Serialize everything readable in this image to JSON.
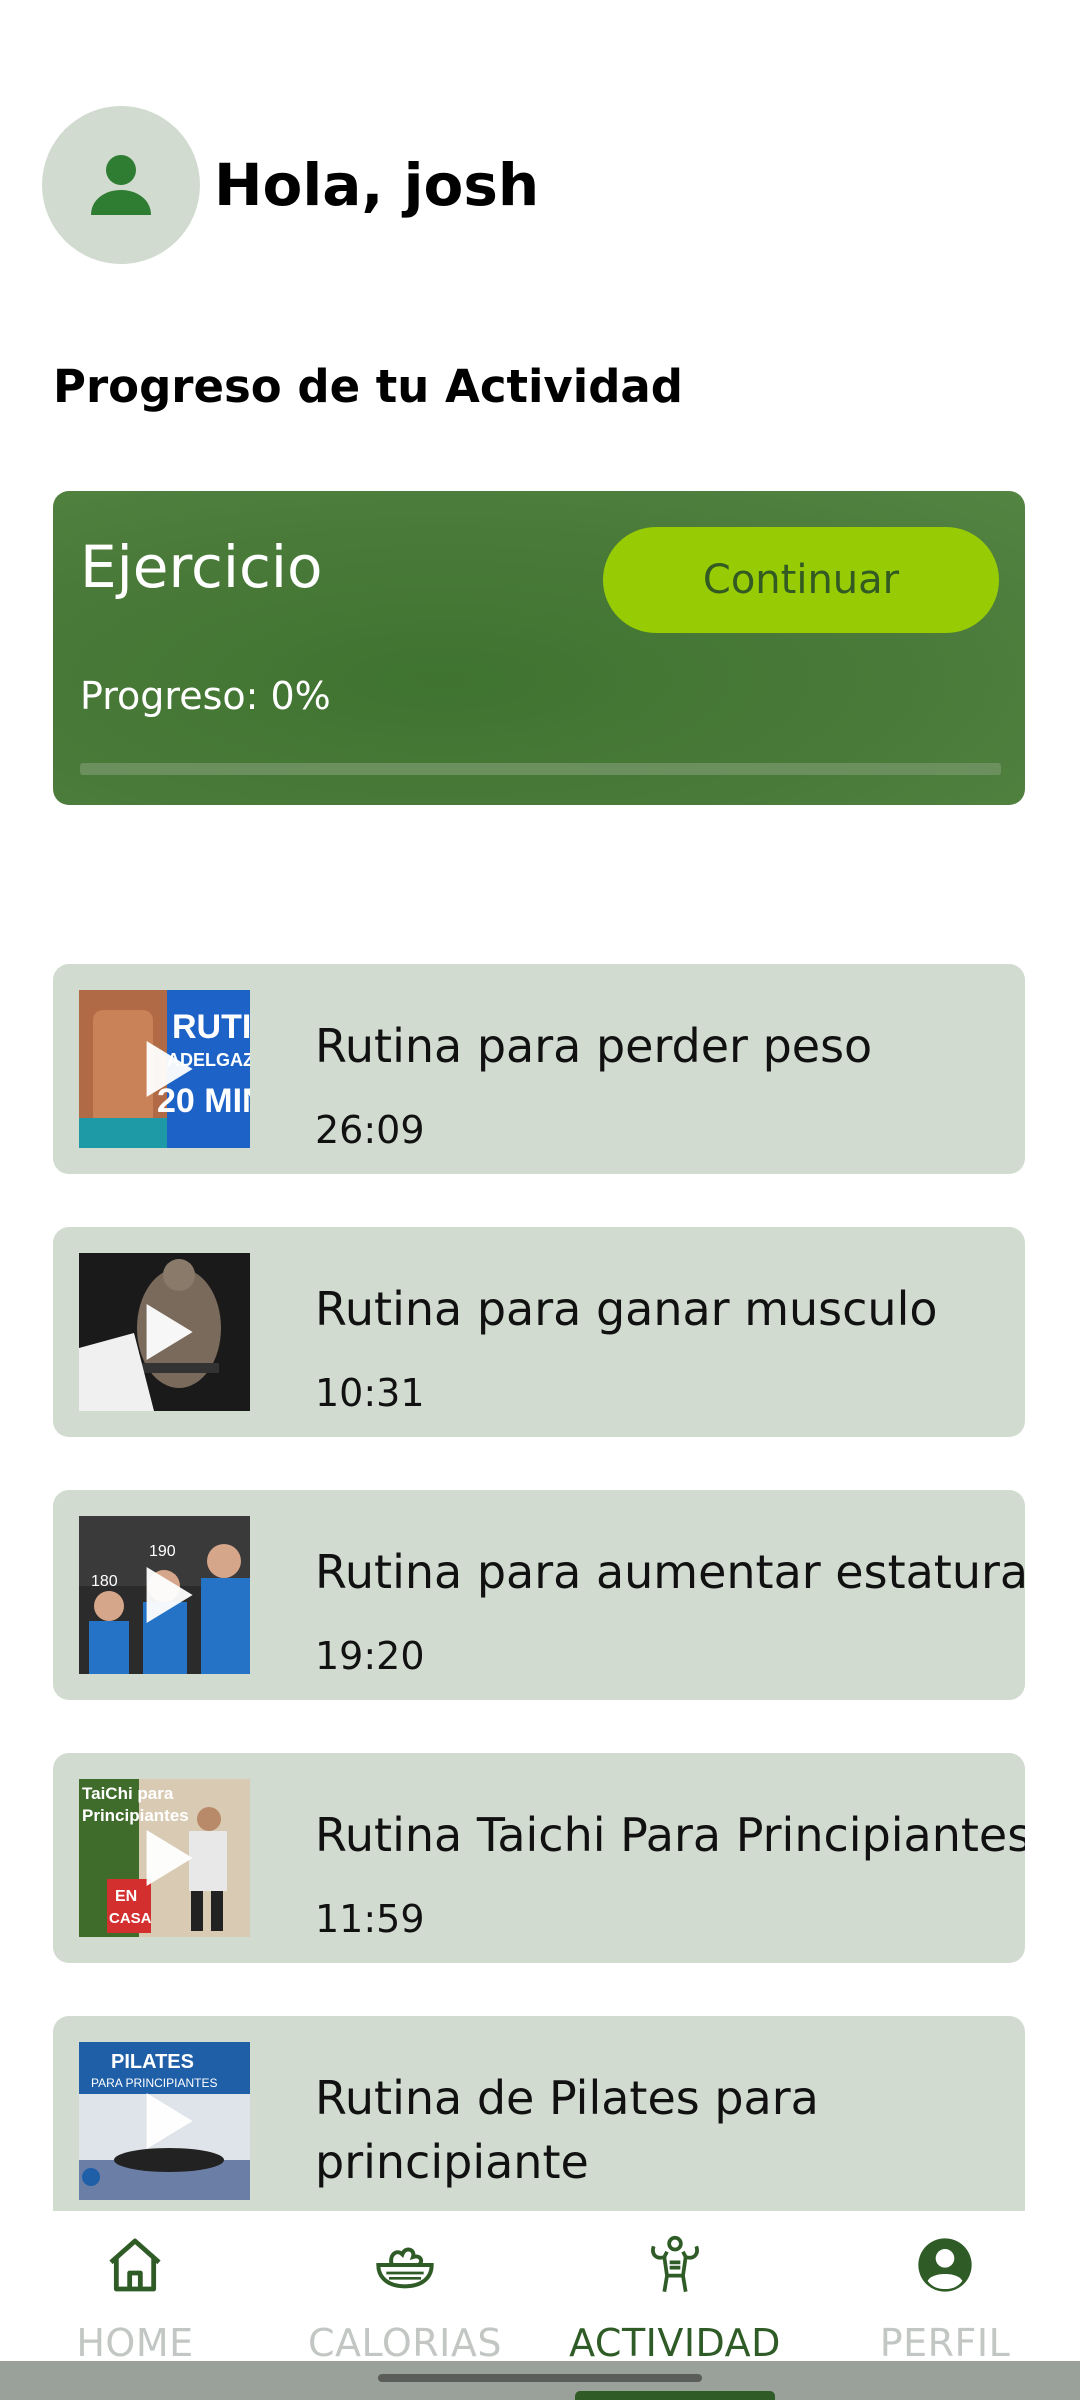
{
  "header": {
    "greeting": "Hola, josh"
  },
  "section": {
    "title": "Progreso de tu Actividad"
  },
  "progress_card": {
    "title": "Ejercicio",
    "button_label": "Continuar",
    "progress_label": "Progreso: 0%",
    "progress_fraction": 0
  },
  "videos": [
    {
      "title": "Rutina para perder peso",
      "duration": "26:09"
    },
    {
      "title": "Rutina para ganar musculo",
      "duration": "10:31"
    },
    {
      "title": "Rutina para aumentar estatura",
      "duration": "19:20"
    },
    {
      "title": "Rutina Taichi Para Principiantes",
      "duration": "11:59"
    },
    {
      "title": "Rutina de Pilates para principiante",
      "duration": ""
    }
  ],
  "thumbnail_text": {
    "t1": [
      "RUTIN",
      "ADELGAZA",
      "20 MIN"
    ],
    "t2": [
      "190",
      "180"
    ],
    "t4": [
      "TaiChi para",
      "Principiantes",
      "EN",
      "CASA"
    ],
    "t5": [
      "PILATES",
      "PARA PRINCIPIANTES"
    ]
  },
  "nav": {
    "items": [
      {
        "label": "HOME",
        "icon": "home-icon"
      },
      {
        "label": "CALORIAS",
        "icon": "salad-bowl-icon"
      },
      {
        "label": "ACTIVIDAD",
        "icon": "muscle-body-icon"
      },
      {
        "label": "PERFIL",
        "icon": "account-circle-icon"
      }
    ],
    "active": "ACTIVIDAD"
  },
  "colors": {
    "primary": "#2f5b26",
    "accent": "#97cc04",
    "card_bg": "#d1dbd0"
  }
}
